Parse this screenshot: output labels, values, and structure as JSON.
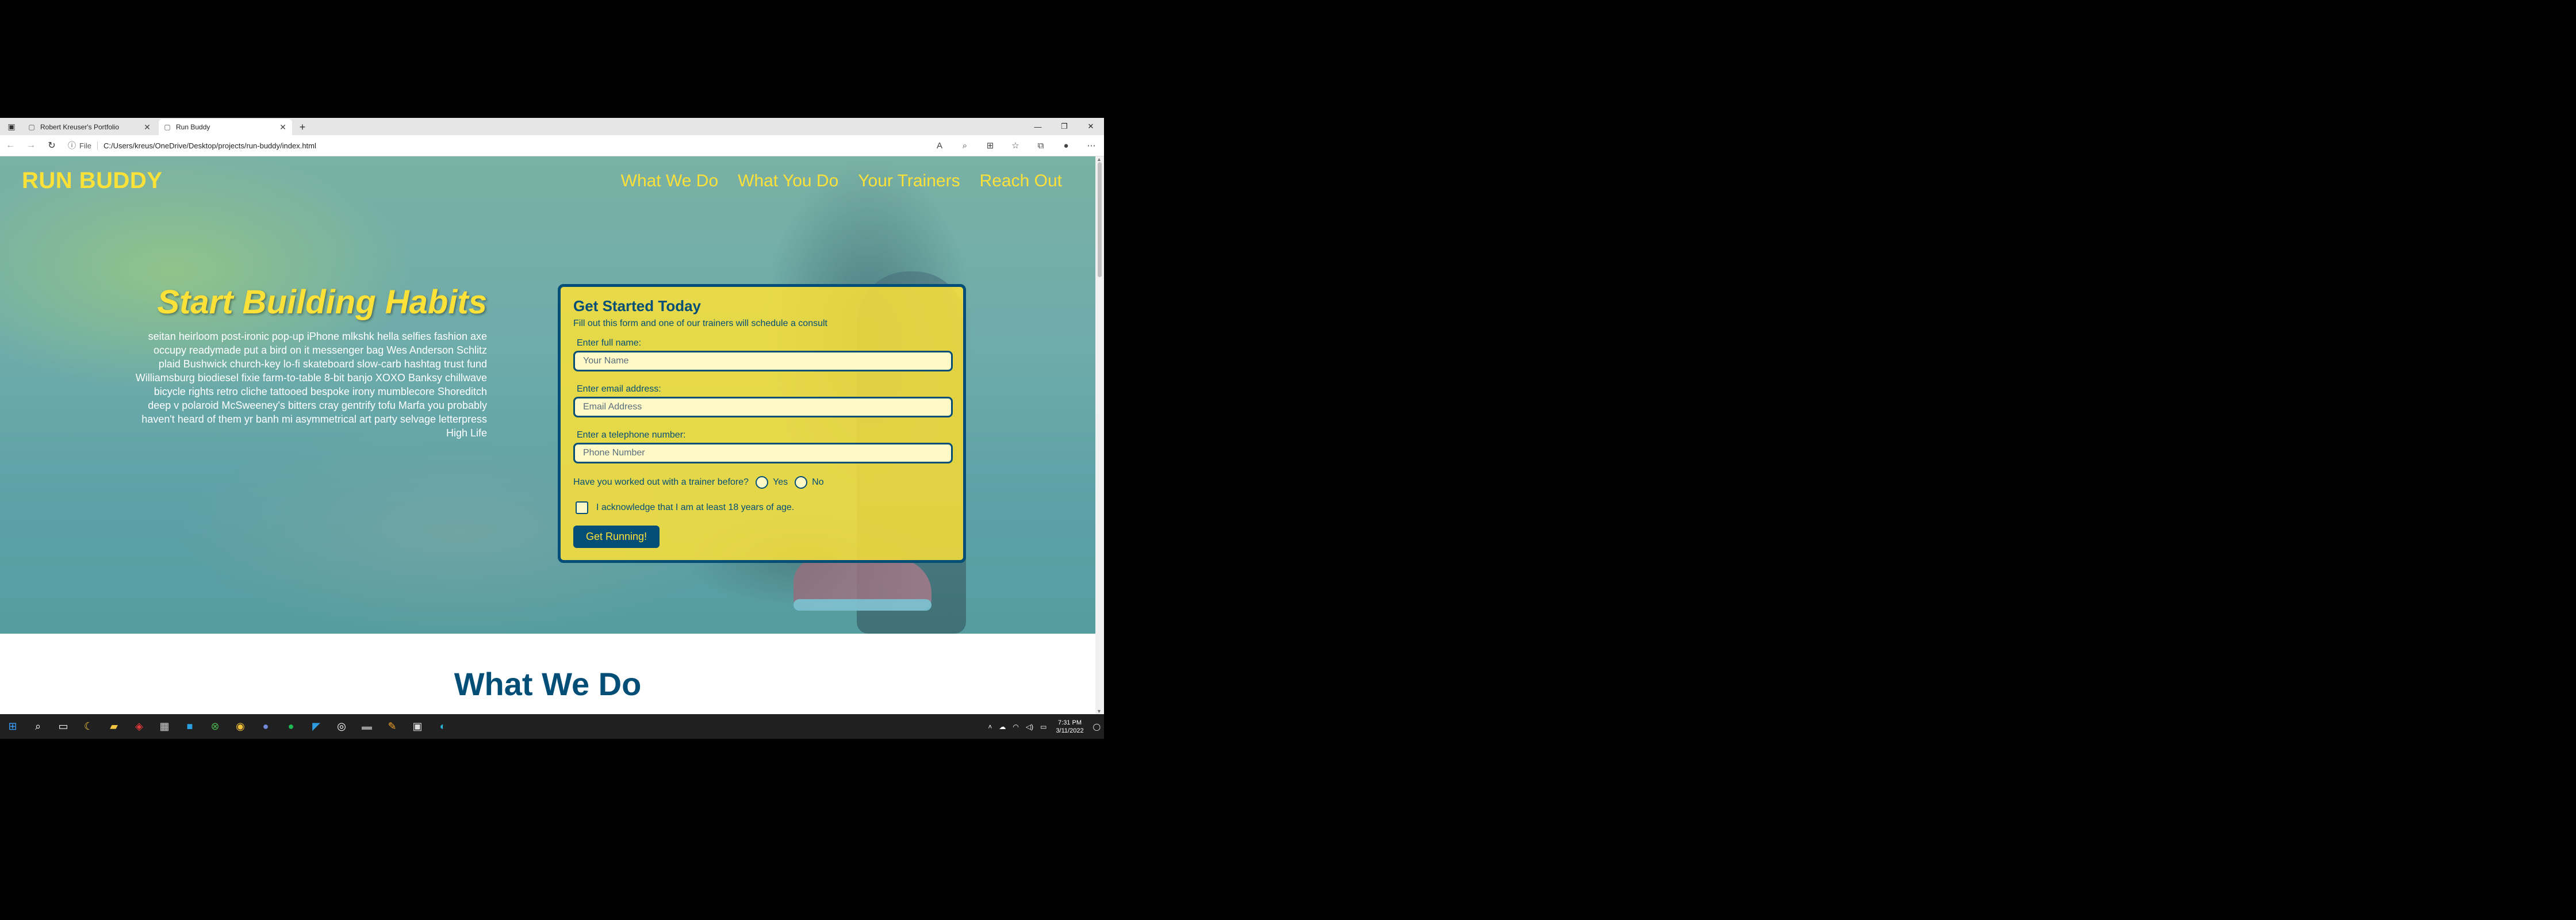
{
  "browser": {
    "tabs": [
      {
        "title": "Robert Kreuser's Portfolio",
        "active": false
      },
      {
        "title": "Run Buddy",
        "active": true
      }
    ],
    "address": {
      "scheme": "File",
      "url": "C:/Users/kreus/OneDrive/Desktop/projects/run-buddy/index.html"
    }
  },
  "page": {
    "logo": "RUN BUDDY",
    "nav": [
      "What We Do",
      "What You Do",
      "Your Trainers",
      "Reach Out"
    ],
    "intro": {
      "heading": "Start Building Habits",
      "body": "seitan heirloom post-ironic pop-up iPhone mlkshk hella selfies fashion axe occupy readymade put a bird on it messenger bag Wes Anderson Schlitz plaid Bushwick church-key lo-fi skateboard slow-carb hashtag trust fund Williamsburg biodiesel fixie farm-to-table 8-bit banjo XOXO Banksy chillwave bicycle rights retro cliche tattooed bespoke irony mumblecore Shoreditch deep v polaroid McSweeney's bitters cray gentrify tofu Marfa you probably haven't heard of them yr banh mi asymmetrical art party selvage letterpress High Life"
    },
    "form": {
      "title": "Get Started Today",
      "subtitle": "Fill out this form and one of our trainers will schedule a consult",
      "name_label": "Enter full name:",
      "name_placeholder": "Your Name",
      "email_label": "Enter email address:",
      "email_placeholder": "Email Address",
      "phone_label": "Enter a telephone number:",
      "phone_placeholder": "Phone Number",
      "trainer_question": "Have you worked out with a trainer before?",
      "yes_label": "Yes",
      "no_label": "No",
      "age_ack": "I acknowledge that I am at least 18 years of age.",
      "submit": "Get Running!"
    },
    "section_title": "What We Do"
  },
  "taskbar": {
    "time": "7:31 PM",
    "date": "3/11/2022"
  },
  "colors": {
    "brand_yellow": "#fce138",
    "brand_blue": "#024e76"
  }
}
